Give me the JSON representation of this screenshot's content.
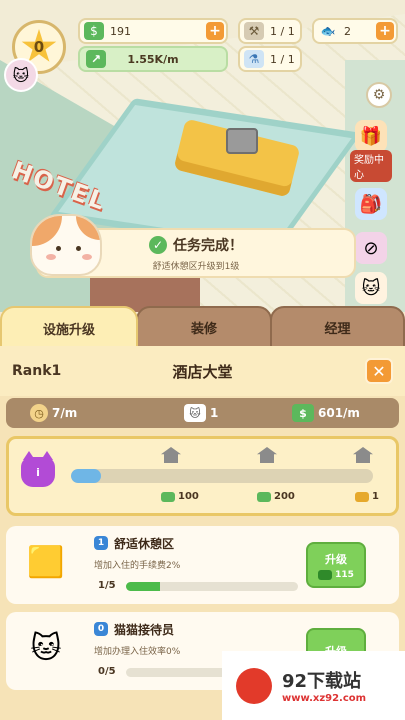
{
  "hud": {
    "rank_level": "0",
    "money": "191",
    "income": "1.55K/m",
    "hammer": "1 / 1",
    "fish": "2",
    "potion": "1 / 1",
    "plus": "+"
  },
  "scene": {
    "hotel_sign": "HOTEL",
    "side_buttons": [
      {
        "label": "奖励中心"
      }
    ]
  },
  "toast": {
    "title": "任务完成！",
    "subtitle": "舒适休憩区升级到1级"
  },
  "tabs": [
    {
      "label": "设施升级",
      "active": true
    },
    {
      "label": "装修",
      "active": false
    },
    {
      "label": "经理",
      "active": false
    }
  ],
  "panel": {
    "rank_label": "Rank1",
    "title": "酒店大堂",
    "close": "✕",
    "stats": {
      "rate": "7/m",
      "cats": "1",
      "income": "601/m"
    },
    "level_progress": {
      "level_badge": "i",
      "progress": 0.1,
      "rewards": [
        "100",
        "200",
        "1"
      ]
    },
    "facilities": [
      {
        "level": "1",
        "name": "舒适休憩区",
        "desc": "增加入住的手续费2%",
        "count": "1/5",
        "progress": 0.2,
        "upgrade_label": "升级",
        "cost": "115"
      },
      {
        "level": "0",
        "name": "猫猫接待员",
        "desc": "增加办理入住效率0%",
        "count": "0/5",
        "progress": 0.0,
        "upgrade_label": "升级",
        "cost": ""
      }
    ]
  },
  "watermark": {
    "big": "92下载站",
    "small": "www.xz92.com"
  }
}
